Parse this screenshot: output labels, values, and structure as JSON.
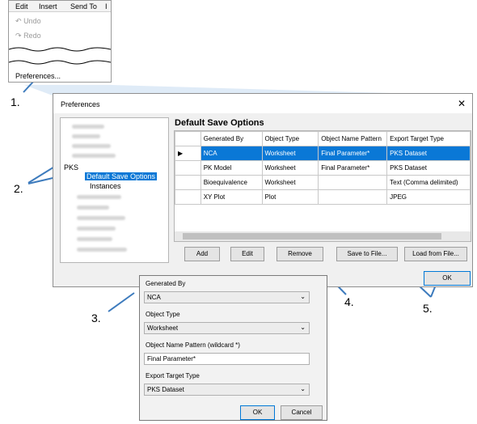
{
  "menu": {
    "tabs": [
      "Edit",
      "Insert",
      "Send To",
      "I"
    ],
    "undo": "Undo",
    "redo": "Redo",
    "preferences": "Preferences..."
  },
  "dialog": {
    "title": "Preferences",
    "close": "✕",
    "section_title": "Default Save Options",
    "tree": {
      "pks": "PKS",
      "default_save_options": "Default Save Options",
      "instances": "Instances"
    },
    "headers": [
      "Generated By",
      "Object Type",
      "Object Name Pattern",
      "Export Target Type"
    ],
    "rows": [
      [
        "NCA",
        "Worksheet",
        "Final Parameter*",
        "PKS Dataset"
      ],
      [
        "PK Model",
        "Worksheet",
        "Final Parameter*",
        "PKS Dataset"
      ],
      [
        "Bioequivalence",
        "Worksheet",
        "",
        "Text (Comma delimited)"
      ],
      [
        "XY Plot",
        "Plot",
        "",
        "JPEG"
      ]
    ],
    "buttons": {
      "add": "Add",
      "edit": "Edit",
      "remove": "Remove",
      "save": "Save to File...",
      "load": "Load from File...",
      "ok": "OK"
    }
  },
  "subdialog": {
    "generated_by_label": "Generated By",
    "generated_by_value": "NCA",
    "object_type_label": "Object Type",
    "object_type_value": "Worksheet",
    "pattern_label": "Object Name Pattern (wildcard *)",
    "pattern_value": "Final Parameter*",
    "export_label": "Export Target Type",
    "export_value": "PKS Dataset",
    "ok": "OK",
    "cancel": "Cancel"
  },
  "callouts": [
    "1.",
    "2.",
    "3.",
    "4.",
    "5."
  ]
}
